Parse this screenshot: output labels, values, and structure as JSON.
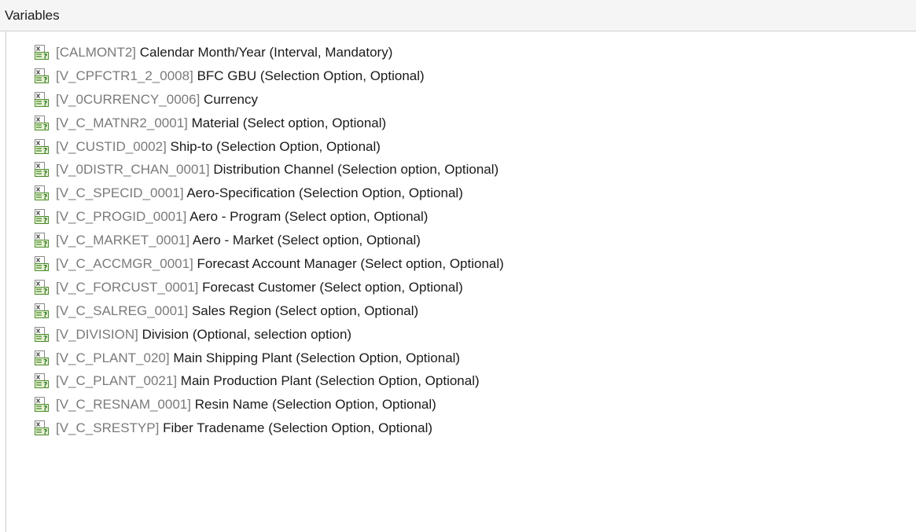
{
  "panel": {
    "title": "Variables"
  },
  "icon_name": "variable-icon",
  "colors": {
    "id_text": "#7a7a7a",
    "desc_text": "#1a1a1a",
    "header_bg": "#f5f5f5"
  },
  "variables": [
    {
      "id": "[CALMONT2]",
      "desc": "Calendar Month/Year (Interval, Mandatory)"
    },
    {
      "id": "[V_CPFCTR1_2_0008]",
      "desc": "BFC GBU (Selection Option, Optional)"
    },
    {
      "id": "[V_0CURRENCY_0006]",
      "desc": "Currency"
    },
    {
      "id": "[V_C_MATNR2_0001]",
      "desc": "Material (Select option, Optional)"
    },
    {
      "id": "[V_CUSTID_0002]",
      "desc": "Ship-to (Selection Option, Optional)"
    },
    {
      "id": "[V_0DISTR_CHAN_0001]",
      "desc": "Distribution Channel (Selection option, Optional)"
    },
    {
      "id": "[V_C_SPECID_0001]",
      "desc": "Aero-Specification (Selection Option, Optional)"
    },
    {
      "id": "[V_C_PROGID_0001]",
      "desc": "Aero - Program (Select option, Optional)"
    },
    {
      "id": "[V_C_MARKET_0001]",
      "desc": "Aero - Market (Select option, Optional)"
    },
    {
      "id": "[V_C_ACCMGR_0001]",
      "desc": "Forecast Account Manager (Select option, Optional)"
    },
    {
      "id": "[V_C_FORCUST_0001]",
      "desc": "Forecast Customer (Select option, Optional)"
    },
    {
      "id": "[V_C_SALREG_0001]",
      "desc": "Sales Region (Select option, Optional)"
    },
    {
      "id": "[V_DIVISION]",
      "desc": "Division (Optional, selection option)"
    },
    {
      "id": "[V_C_PLANT_020]",
      "desc": "Main Shipping Plant (Selection Option, Optional)"
    },
    {
      "id": "[V_C_PLANT_0021]",
      "desc": "Main Production Plant (Selection Option, Optional)"
    },
    {
      "id": "[V_C_RESNAM_0001]",
      "desc": "Resin Name (Selection Option, Optional)"
    },
    {
      "id": "[V_C_SRESTYP]",
      "desc": "Fiber Tradename (Selection Option, Optional)"
    }
  ]
}
